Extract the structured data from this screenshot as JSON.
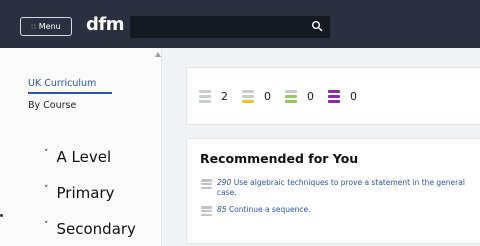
{
  "header": {
    "menu_icon": "grid-dots-icon",
    "menu_label": "Menu",
    "logo": "dfm",
    "search": {
      "placeholder": "",
      "icon": "search-icon"
    }
  },
  "sidebar": {
    "tabs": [
      {
        "label": "UK Curriculum",
        "active": true
      },
      {
        "label": "By Course",
        "active": false
      }
    ],
    "items": [
      {
        "label": "A Level",
        "icon": "chevron-down-icon"
      },
      {
        "label": "Primary",
        "icon": "chevron-down-icon"
      },
      {
        "label": "Secondary",
        "icon": "chevron-down-icon"
      }
    ]
  },
  "stats": [
    {
      "value": "2",
      "color": "#c8cbd0"
    },
    {
      "value": "0",
      "color": "#e6c42a"
    },
    {
      "value": "0",
      "color": "#92c95a"
    },
    {
      "value": "0",
      "color": "#8a2aa0"
    }
  ],
  "recommended": {
    "title": "Recommended for You",
    "items": [
      {
        "number": "290",
        "text": "Use algebraic techniques to prove a statement in the general case."
      },
      {
        "number": "85",
        "text": "Continue a sequence."
      }
    ]
  },
  "colors": {
    "topbar": "#2b3040",
    "link": "#2a55a8"
  }
}
